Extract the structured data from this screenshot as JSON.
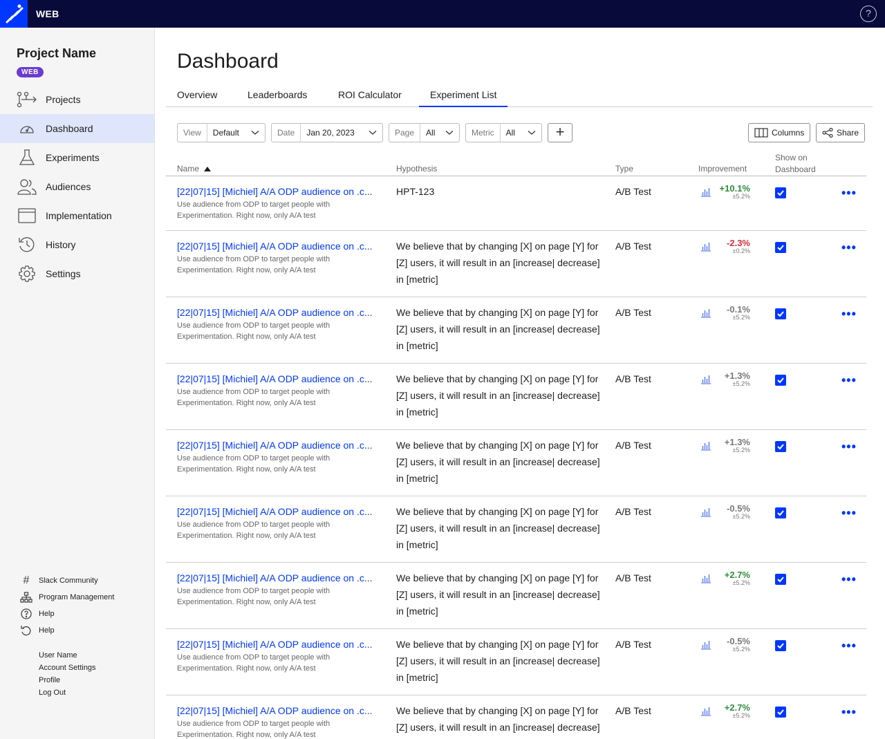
{
  "topbar": {
    "title": "WEB",
    "help_glyph": "?"
  },
  "sidebar": {
    "project_name": "Project Name",
    "badge": "WEB",
    "nav": [
      {
        "label": "Projects",
        "icon": "projects-icon"
      },
      {
        "label": "Dashboard",
        "icon": "dashboard-icon",
        "active": true
      },
      {
        "label": "Experiments",
        "icon": "flask-icon"
      },
      {
        "label": "Audiences",
        "icon": "audiences-icon"
      },
      {
        "label": "Implementation",
        "icon": "browser-window-icon"
      },
      {
        "label": "History",
        "icon": "history-icon"
      },
      {
        "label": "Settings",
        "icon": "gear-icon"
      }
    ],
    "footer": [
      {
        "label": "Slack Community",
        "icon": "hash-icon"
      },
      {
        "label": "Program Management",
        "icon": "org-chart-icon"
      },
      {
        "label": "Help",
        "icon": "help-icon"
      },
      {
        "label": "Help",
        "icon": "undo-icon"
      }
    ],
    "user": [
      "User Name",
      "Account Settings",
      "Profile",
      "Log Out"
    ]
  },
  "main": {
    "title": "Dashboard",
    "tabs": [
      "Overview",
      "Leaderboards",
      "ROI Calculator",
      "Experiment List"
    ],
    "active_tab": "Experiment List",
    "filters": {
      "view": {
        "label": "View",
        "value": "Default"
      },
      "date": {
        "label": "Date",
        "value": "Jan 20, 2023"
      },
      "page": {
        "label": "Page",
        "value": "All"
      },
      "metric": {
        "label": "Metric",
        "value": "All"
      }
    },
    "add_glyph": "+",
    "buttons": {
      "columns": "Columns",
      "share": "Share"
    }
  },
  "table": {
    "columns": {
      "name": "Name",
      "hypothesis": "Hypothesis",
      "type": "Type",
      "improvement": "Improvement",
      "show_line1": "Show on",
      "show_line2": "Dashboard"
    },
    "more_glyph": "•••",
    "rows": [
      {
        "name": "[22|07|15] [Michiel] A/A ODP audience on .c...",
        "desc": "Use audience from ODP to target people with Experimentation. Right now, only A/A test",
        "hypothesis": "HPT-123",
        "type": "A/B Test",
        "improvement": "+10.1%",
        "ci": "±5.2%",
        "tone": "pos",
        "show": true
      },
      {
        "name": "[22|07|15] [Michiel] A/A ODP audience on .c...",
        "desc": "Use audience from ODP to target people with Experimentation. Right now, only A/A test",
        "hypothesis": "We believe that by changing [X] on page [Y] for [Z] users, it will result in an [increase| decrease] in [metric]",
        "type": "A/B Test",
        "improvement": "-2.3%",
        "ci": "±0.2%",
        "tone": "neg",
        "show": true
      },
      {
        "name": "[22|07|15] [Michiel] A/A ODP audience on .c...",
        "desc": "Use audience from ODP to target people with Experimentation. Right now, only A/A test",
        "hypothesis": "We believe that by changing [X] on page [Y] for [Z] users, it will result in an [increase| decrease] in [metric]",
        "type": "A/B Test",
        "improvement": "-0.1%",
        "ci": "±5.2%",
        "tone": "neu",
        "show": true
      },
      {
        "name": "[22|07|15] [Michiel] A/A ODP audience on .c...",
        "desc": "Use audience from ODP to target people with Experimentation. Right now, only A/A test",
        "hypothesis": "We believe that by changing [X] on page [Y] for [Z] users, it will result in an [increase| decrease] in [metric]",
        "type": "A/B Test",
        "improvement": "+1.3%",
        "ci": "±5.2%",
        "tone": "neu",
        "show": true
      },
      {
        "name": "[22|07|15] [Michiel] A/A ODP audience on .c...",
        "desc": "Use audience from ODP to target people with Experimentation. Right now, only A/A test",
        "hypothesis": "We believe that by changing [X] on page [Y] for [Z] users, it will result in an [increase| decrease] in [metric]",
        "type": "A/B Test",
        "improvement": "+1.3%",
        "ci": "±5.2%",
        "tone": "neu",
        "show": true
      },
      {
        "name": "[22|07|15] [Michiel] A/A ODP audience on .c...",
        "desc": "Use audience from ODP to target people with Experimentation. Right now, only A/A test",
        "hypothesis": "We believe that by changing [X] on page [Y] for [Z] users, it will result in an [increase| decrease] in [metric]",
        "type": "A/B Test",
        "improvement": "-0.5%",
        "ci": "±5.2%",
        "tone": "neu",
        "show": true
      },
      {
        "name": "[22|07|15] [Michiel] A/A ODP audience on .c...",
        "desc": "Use audience from ODP to target people with Experimentation. Right now, only A/A test",
        "hypothesis": "We believe that by changing [X] on page [Y] for [Z] users, it will result in an [increase| decrease] in [metric]",
        "type": "A/B Test",
        "improvement": "+2.7%",
        "ci": "±5.2%",
        "tone": "pos",
        "show": true
      },
      {
        "name": "[22|07|15] [Michiel] A/A ODP audience on .c...",
        "desc": "Use audience from ODP to target people with Experimentation. Right now, only A/A test",
        "hypothesis": "We believe that by changing [X] on page [Y] for [Z] users, it will result in an [increase| decrease] in [metric]",
        "type": "A/B Test",
        "improvement": "-0.5%",
        "ci": "±5.2%",
        "tone": "neu",
        "show": true
      },
      {
        "name": "[22|07|15] [Michiel] A/A ODP audience on .c...",
        "desc": "Use audience from ODP to target people with Experimentation. Right now, only A/A test",
        "hypothesis": "We believe that by changing [X] on page [Y] for [Z] users, it will result in an [increase| decrease] in [metric]",
        "type": "A/B Test",
        "improvement": "+2.7%",
        "ci": "±5.2%",
        "tone": "pos",
        "show": true
      }
    ]
  },
  "colors": {
    "accent": "#0037ff",
    "topbar": "#080a3a",
    "positive": "#2f8c3c",
    "negative": "#d0303a",
    "badge": "#6b3cd0"
  }
}
